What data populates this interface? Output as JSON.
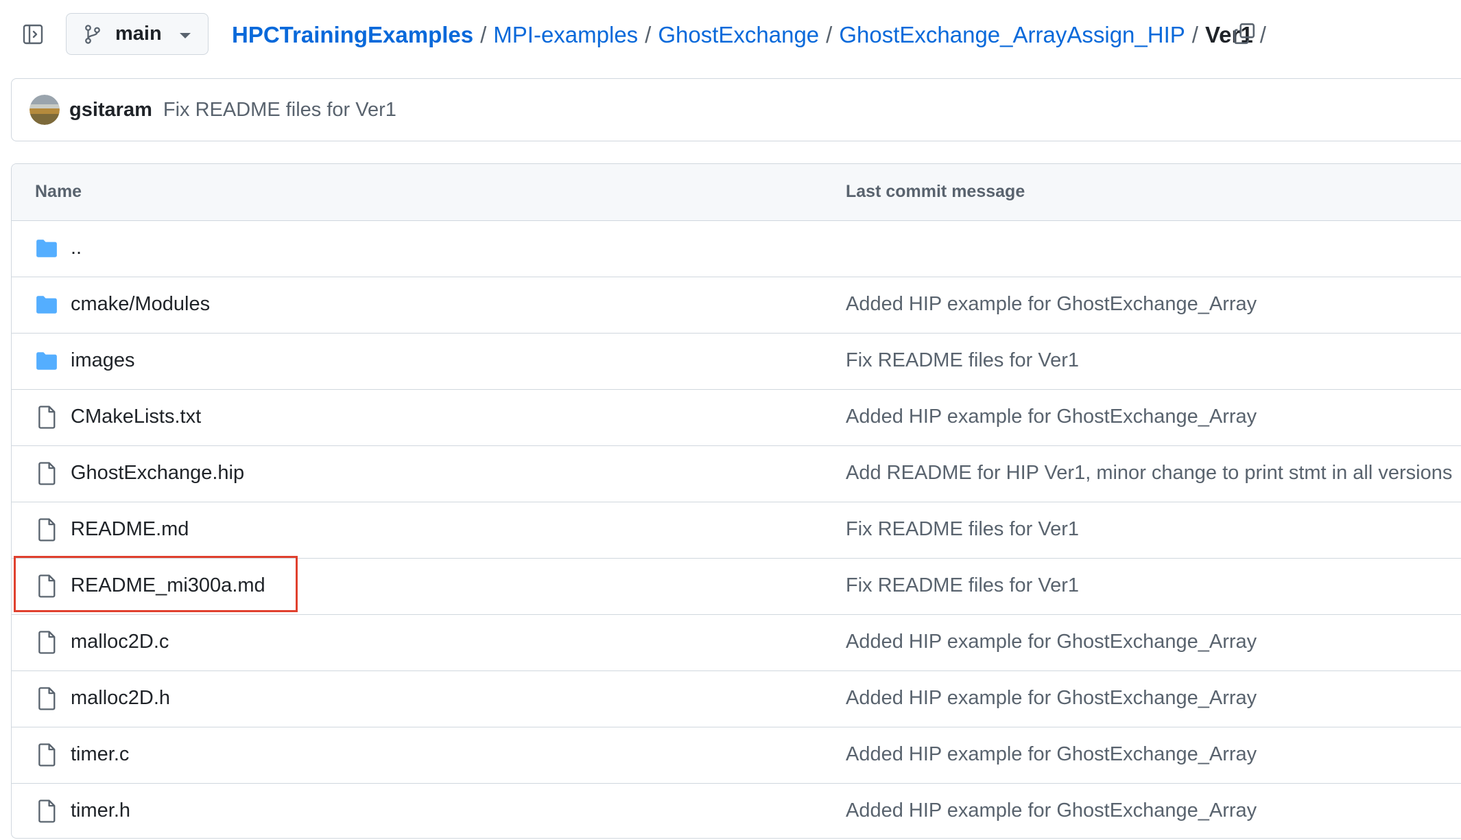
{
  "branch": {
    "label": "main"
  },
  "breadcrumb": {
    "items": [
      "HPCTrainingExamples",
      "MPI-examples",
      "GhostExchange",
      "GhostExchange_ArrayAssign_HIP"
    ],
    "separator": "/",
    "current": "Ver1",
    "trailing_separator": "/"
  },
  "commit": {
    "author": "gsitaram",
    "message": "Fix README files for Ver1"
  },
  "table": {
    "headers": {
      "name": "Name",
      "last_commit": "Last commit message"
    },
    "rows": [
      {
        "type": "folder",
        "icon": "folder-icon",
        "name": "..",
        "commit": ""
      },
      {
        "type": "folder",
        "icon": "folder-icon",
        "name": "cmake/Modules",
        "commit": "Added HIP example for GhostExchange_Array"
      },
      {
        "type": "folder",
        "icon": "folder-icon",
        "name": "images",
        "commit": "Fix README files for Ver1"
      },
      {
        "type": "file",
        "icon": "file-icon",
        "name": "CMakeLists.txt",
        "commit": "Added HIP example for GhostExchange_Array"
      },
      {
        "type": "file",
        "icon": "file-icon",
        "name": "GhostExchange.hip",
        "commit": "Add README for HIP Ver1, minor change to print stmt in all versions"
      },
      {
        "type": "file",
        "icon": "file-icon",
        "name": "README.md",
        "commit": "Fix README files for Ver1"
      },
      {
        "type": "file",
        "icon": "file-icon",
        "name": "README_mi300a.md",
        "commit": "Fix README files for Ver1",
        "highlighted": true
      },
      {
        "type": "file",
        "icon": "file-icon",
        "name": "malloc2D.c",
        "commit": "Added HIP example for GhostExchange_Array"
      },
      {
        "type": "file",
        "icon": "file-icon",
        "name": "malloc2D.h",
        "commit": "Added HIP example for GhostExchange_Array"
      },
      {
        "type": "file",
        "icon": "file-icon",
        "name": "timer.c",
        "commit": "Added HIP example for GhostExchange_Array"
      },
      {
        "type": "file",
        "icon": "file-icon",
        "name": "timer.h",
        "commit": "Added HIP example for GhostExchange_Array"
      }
    ]
  },
  "colors": {
    "link": "#0969da",
    "muted": "#59636e",
    "border": "#d0d7de",
    "folder": "#54aeff",
    "highlight": "#e0402e"
  }
}
